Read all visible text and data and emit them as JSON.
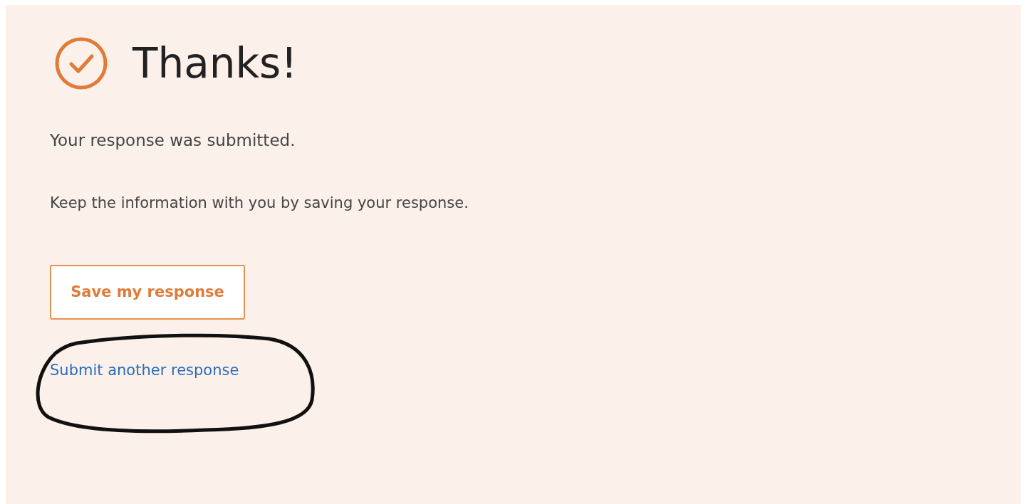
{
  "heading": "Thanks!",
  "message": "Your response was submitted.",
  "note": "Keep the information with you by saving your response.",
  "save_button": "Save my response",
  "another_link": "Submit another response"
}
